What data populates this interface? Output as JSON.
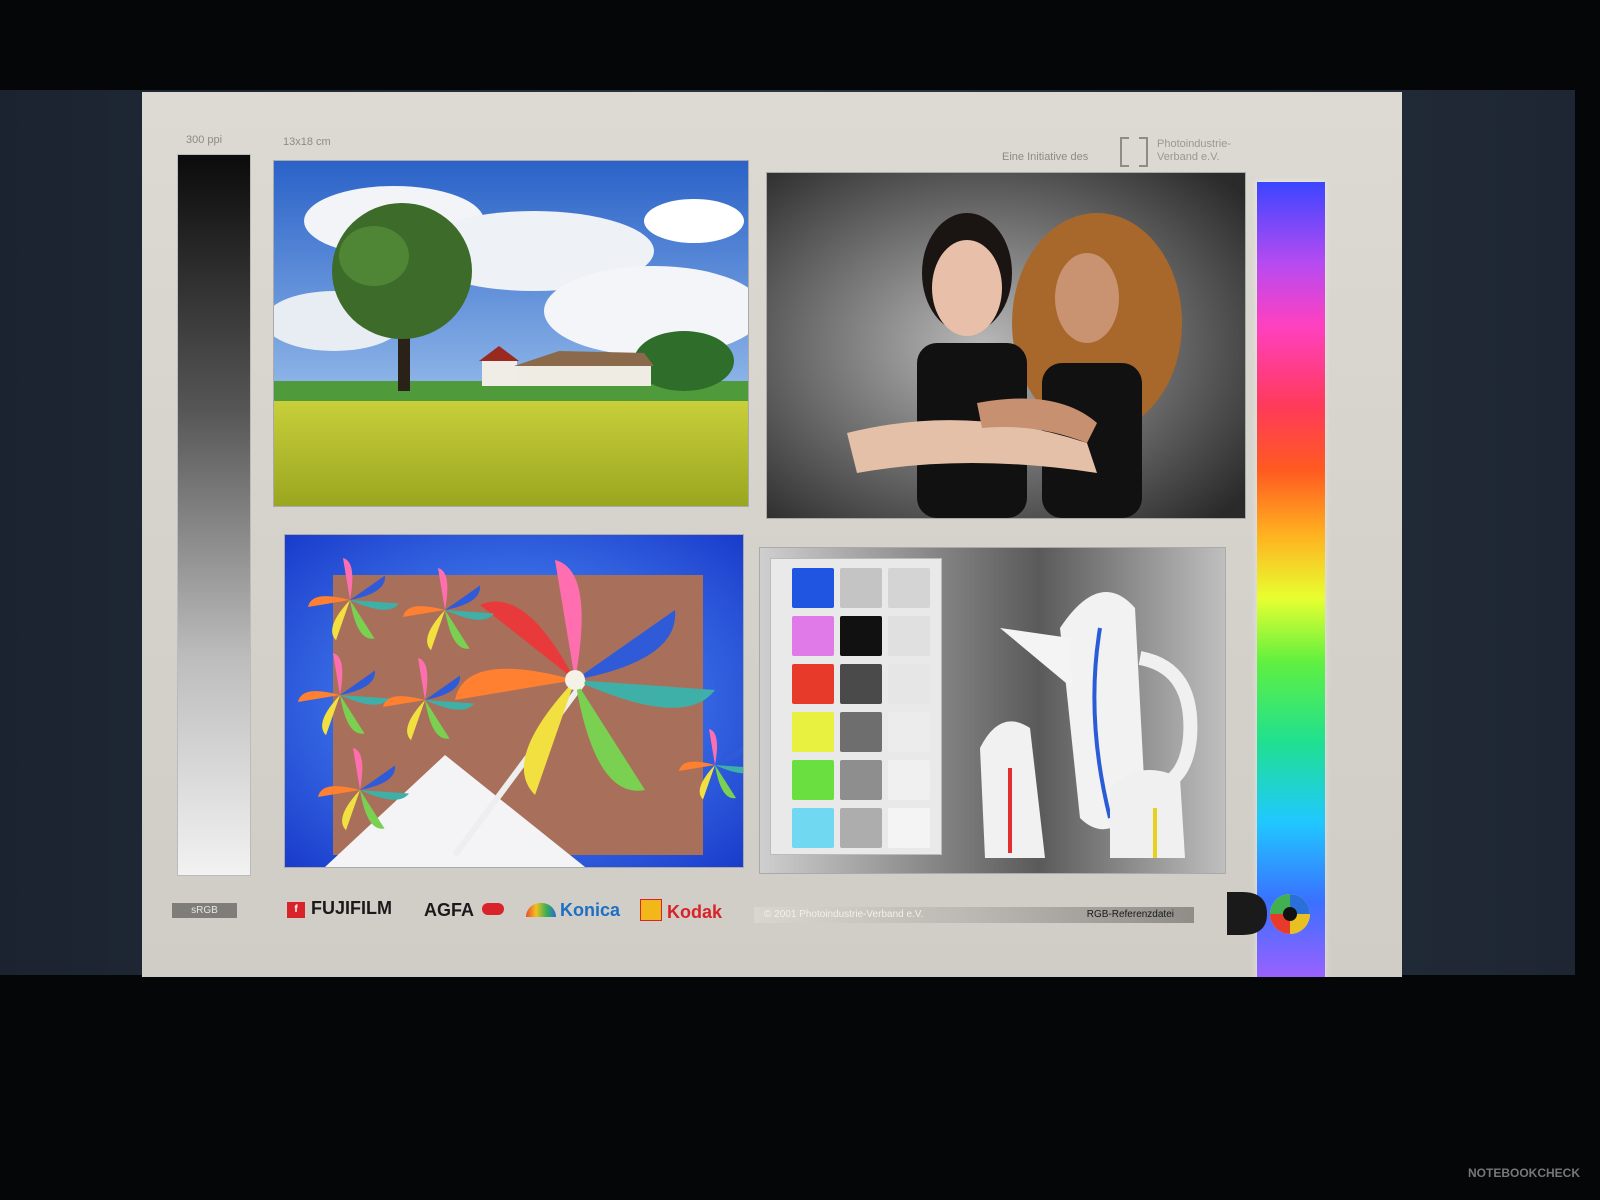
{
  "header": {
    "resolution": "300 ppi",
    "size": "13x18 cm",
    "initiative": "Eine Initiative des",
    "org_line1": "Photoindustrie-",
    "org_line2": "Verband e.V."
  },
  "footer": {
    "colorspace": "sRGB",
    "copyright": "© 2001 Photoindustrie-Verband e.V.",
    "reference": "RGB-Referenzdatei",
    "brands": [
      "FUJIFILM",
      "AGFA",
      "Konica",
      "Kodak"
    ]
  },
  "photos": {
    "landscape": "tree-farmhouse-rapeseed-field",
    "portrait": "two-women-portrait",
    "pinwheels": "colorful-pinwheels",
    "still_life": "color-patches-and-ceramic-jug"
  },
  "colors": {
    "screen_bg": "#d6d4cc",
    "bezel": "#232c3a",
    "brand_red": "#d8232a",
    "konica_blue": "#1c6fc4"
  },
  "watermark": "NOTEBOOKCHECK"
}
